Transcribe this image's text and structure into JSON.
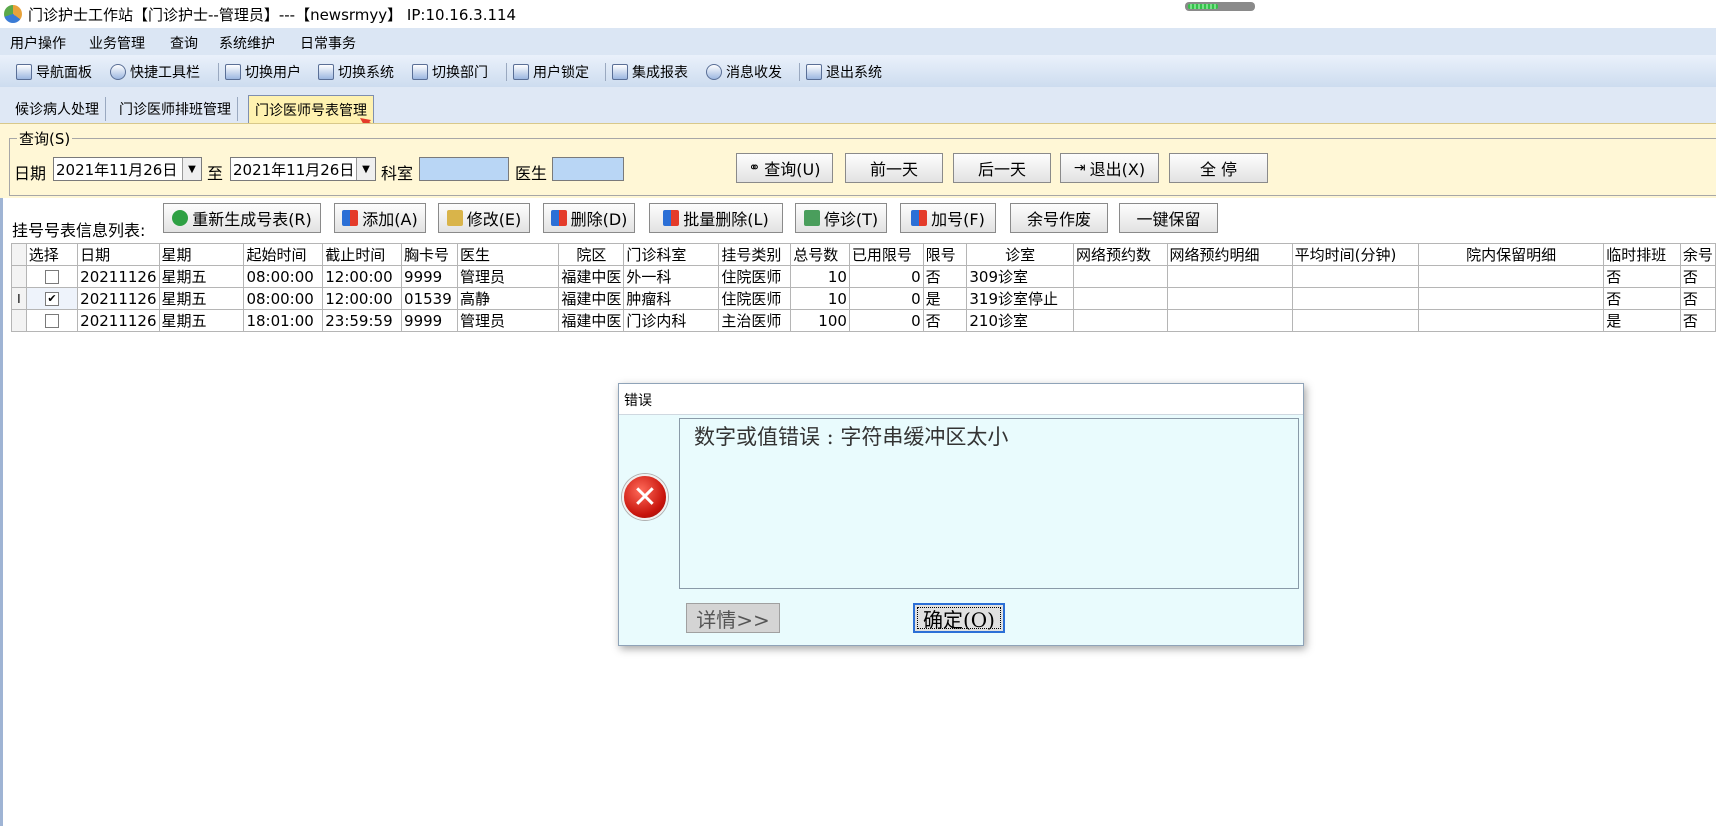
{
  "window": {
    "title": "门诊护士工作站【门诊护士--管理员】---【newsrmyy】 IP:10.16.3.114"
  },
  "menu": [
    "用户操作",
    "业务管理",
    "查询",
    "系统维护",
    "日常事务"
  ],
  "toolbar": [
    {
      "label": "导航面板",
      "icon": "navigation-panel-icon"
    },
    {
      "label": "快捷工具栏",
      "icon": "tools-icon"
    },
    {
      "label": "切换用户",
      "icon": "switch-user-icon"
    },
    {
      "label": "切换系统",
      "icon": "switch-system-icon"
    },
    {
      "label": "切换部门",
      "icon": "switch-department-icon"
    },
    {
      "label": "用户锁定",
      "icon": "user-lock-icon"
    },
    {
      "label": "集成报表",
      "icon": "report-icon"
    },
    {
      "label": "消息收发",
      "icon": "info-icon"
    },
    {
      "label": "退出系统",
      "icon": "exit-icon"
    }
  ],
  "tabs": [
    {
      "label": "候诊病人处理",
      "active": false
    },
    {
      "label": "门诊医师排班管理",
      "active": false
    },
    {
      "label": "门诊医师号表管理",
      "active": true
    }
  ],
  "query": {
    "legend": "查询(S)",
    "date_label": "日期",
    "date_from": "2021年11月26日",
    "to_label": "至",
    "date_to": "2021年11月26日",
    "dept_label": "科室",
    "dept_value": "",
    "doctor_label": "医生",
    "doctor_value": "",
    "buttons": {
      "search": "查询(U)",
      "prev_day": "前一天",
      "next_day": "后一天",
      "exit": "退出(X)",
      "stop_all": "全 停"
    }
  },
  "list": {
    "label": "挂号号表信息列表:",
    "buttons": {
      "regenerate": "重新生成号表(R)",
      "add": "添加(A)",
      "edit": "修改(E)",
      "delete": "删除(D)",
      "batch_delete": "批量删除(L)",
      "stop_clinic": "停诊(T)",
      "add_number": "加号(F)",
      "void_remaining": "余号作废",
      "one_click_keep": "一键保留"
    }
  },
  "grid": {
    "columns": [
      "选择",
      "日期",
      "星期",
      "起始时间",
      "截止时间",
      "胸卡号",
      "医生",
      "院区",
      "门诊科室",
      "挂号类别",
      "总号数",
      "已用限号",
      "限号",
      "诊室",
      "网络预约数",
      "网络预约明细",
      "平均时间(分钟)",
      "院内保留明细",
      "临时排班",
      "余号"
    ],
    "rows": [
      {
        "indicator": "",
        "checked": false,
        "date": "20211126",
        "week": "星期五",
        "start": "08:00:00",
        "end": "12:00:00",
        "badge": "9999",
        "doctor": "管理员",
        "campus": "福建中医",
        "dept": "外一科",
        "type": "住院医师",
        "total": "10",
        "used": "0",
        "limit": "否",
        "room": "309诊室",
        "net_count": "",
        "net_detail": "",
        "avg_time": "",
        "keep_detail": "",
        "temp": "否",
        "remain": "否"
      },
      {
        "indicator": "I",
        "checked": true,
        "date": "20211126",
        "week": "星期五",
        "start": "08:00:00",
        "end": "12:00:00",
        "badge": "01539",
        "doctor": "高静",
        "campus": "福建中医",
        "dept": "肿瘤科",
        "type": "住院医师",
        "total": "10",
        "used": "0",
        "limit": "是",
        "room": "319诊室停止",
        "net_count": "",
        "net_detail": "",
        "avg_time": "",
        "keep_detail": "",
        "temp": "否",
        "remain": "否"
      },
      {
        "indicator": "",
        "checked": false,
        "date": "20211126",
        "week": "星期五",
        "start": "18:01:00",
        "end": "23:59:59",
        "badge": "9999",
        "doctor": "管理员",
        "campus": "福建中医",
        "dept": "门诊内科",
        "type": "主治医师",
        "total": "100",
        "used": "0",
        "limit": "否",
        "room": "210诊室",
        "net_count": "",
        "net_detail": "",
        "avg_time": "",
        "keep_detail": "",
        "temp": "是",
        "remain": "否"
      }
    ]
  },
  "dialog": {
    "title": "错误",
    "message": "数字或值错误 :  字符串缓冲区太小",
    "detail_button": "详情>>",
    "ok_button": "确定(O)",
    "icon": "error-icon"
  },
  "colors": {
    "query_bg": "#fff7d6",
    "input_bg": "#b9d6f5",
    "dialog_bg": "#e9fbfd",
    "active_tab": "#fff2b0"
  }
}
